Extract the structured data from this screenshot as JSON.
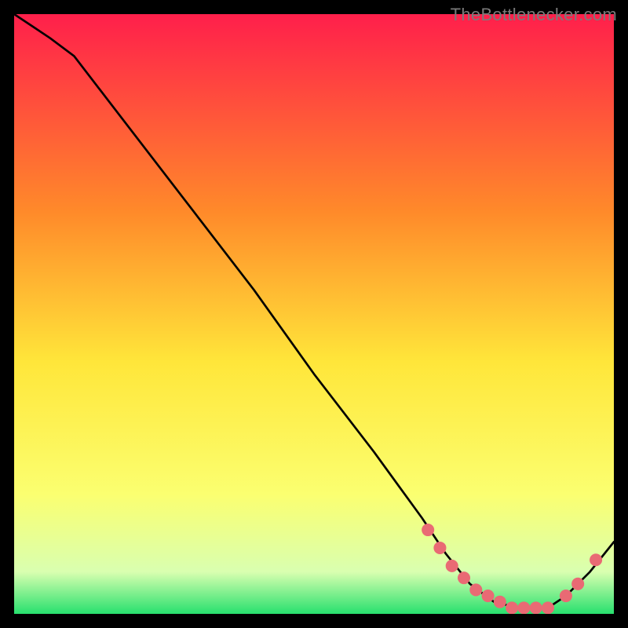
{
  "watermark": "TheBottlenecker.com",
  "colors": {
    "bg": "#000000",
    "grad_top": "#ff1f4b",
    "grad_mid_upper": "#ff8a2a",
    "grad_mid": "#ffe63a",
    "grad_lower": "#fbff70",
    "grad_near_bottom": "#d9ffb0",
    "grad_bottom": "#28e06e",
    "line": "#000000",
    "marker": "#e96a74"
  },
  "chart_data": {
    "type": "line",
    "title": "",
    "xlabel": "",
    "ylabel": "",
    "xlim": [
      0,
      100
    ],
    "ylim": [
      0,
      100
    ],
    "series": [
      {
        "name": "curve",
        "x": [
          0,
          3,
          6,
          10,
          20,
          30,
          40,
          50,
          60,
          68,
          72,
          76,
          80,
          84,
          87,
          89,
          92,
          96,
          100
        ],
        "y": [
          100,
          98,
          96,
          93,
          80,
          67,
          54,
          40,
          27,
          16,
          10,
          5,
          2,
          1,
          1,
          1,
          3,
          7,
          12
        ]
      }
    ],
    "markers": {
      "name": "optimal-band",
      "x": [
        69,
        71,
        73,
        75,
        77,
        79,
        81,
        83,
        85,
        87,
        89,
        92,
        94,
        97
      ],
      "y": [
        14,
        11,
        8,
        6,
        4,
        3,
        2,
        1,
        1,
        1,
        1,
        3,
        5,
        9
      ]
    }
  }
}
